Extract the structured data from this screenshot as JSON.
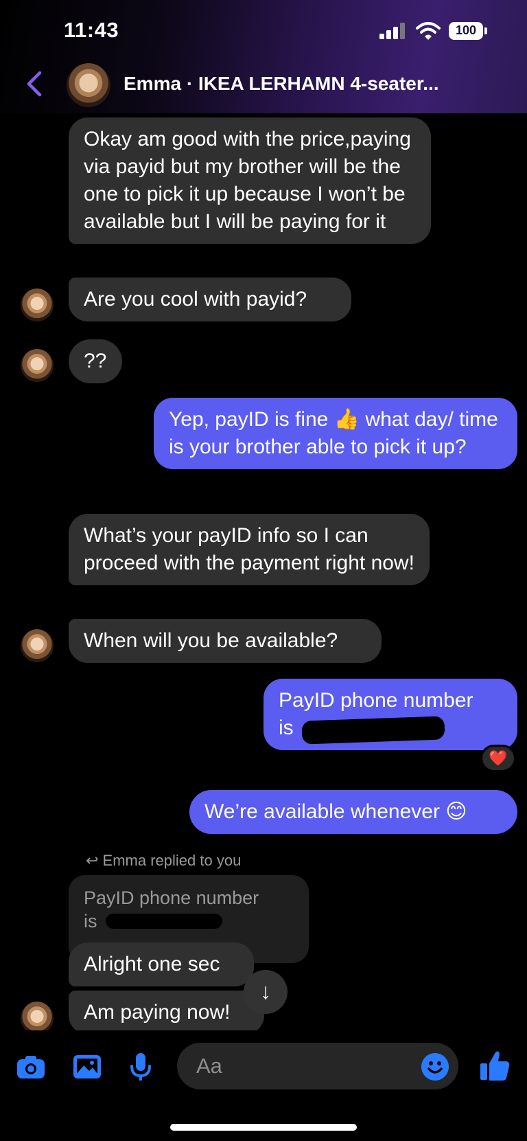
{
  "status": {
    "time": "11:43",
    "battery": "100"
  },
  "header": {
    "title": "Emma · IKEA LERHAMN 4-seater..."
  },
  "messages": {
    "m1": "Okay am good with the price,paying via payid but my brother will be the one to pick it up because I won’t be available but I will be paying for it",
    "m2": "Are you cool with payid?",
    "m3": "??",
    "m4a": "Yep, payID is fine",
    "m4b": "👍",
    "m4c": "what day/ time is your brother able to pick it up?",
    "m5": "What’s your payID info so I can proceed with the payment right now!",
    "m6": "When will you be available?",
    "m7a": "PayID phone number",
    "m7b": "is",
    "m7_reaction": "❤️",
    "m8": "We’re available whenever 😊",
    "reply_note": "↩ Emma replied to you",
    "quoted_a": "PayID phone number",
    "quoted_b": "is",
    "m9": "Alright one sec",
    "m10": "Am paying now!"
  },
  "composer": {
    "placeholder": "Aa"
  },
  "colors": {
    "outgoing": "#5b5cf0",
    "incoming": "#303030",
    "accent": "#2a7bff",
    "back_arrow": "#8a5cf0"
  }
}
